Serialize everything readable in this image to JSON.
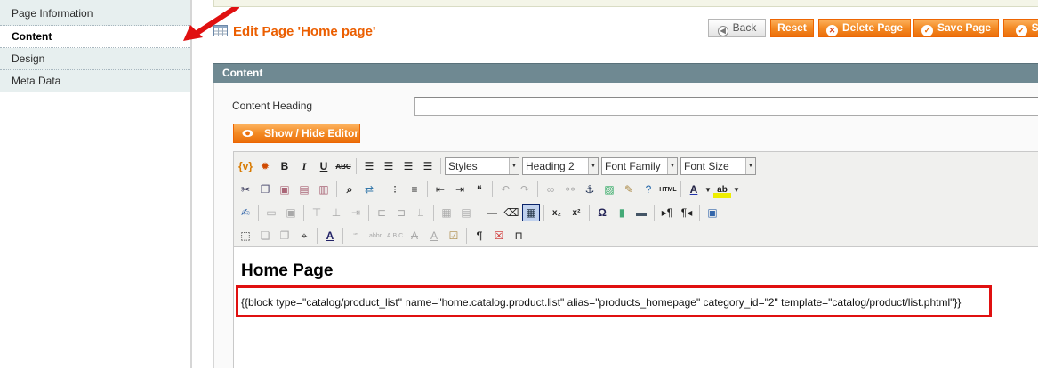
{
  "sidebar": {
    "items": [
      {
        "label": "Page Information",
        "active": false
      },
      {
        "label": "Content",
        "active": true
      },
      {
        "label": "Design",
        "active": false
      },
      {
        "label": "Meta Data",
        "active": false
      }
    ]
  },
  "header": {
    "title": "Edit Page 'Home page'"
  },
  "buttons": {
    "back": "Back",
    "reset": "Reset",
    "delete": "Delete Page",
    "save": "Save Page",
    "save_continue": "Sa"
  },
  "section": {
    "title": "Content"
  },
  "form": {
    "content_heading_label": "Content Heading",
    "content_heading_value": "",
    "toggle_editor_label": "Show / Hide Editor"
  },
  "editor": {
    "selects": {
      "styles": "Styles",
      "format": "Heading 2",
      "font_family": "Font Family",
      "font_size": "Font Size"
    },
    "content": {
      "heading": "Home Page",
      "widget_code": "{{block type=\"catalog/product_list\" name=\"home.catalog.product.list\" alias=\"products_homepage\" category_id=\"2\" template=\"catalog/product/list.phtml\"}}"
    }
  },
  "colors": {
    "accent_orange": "#eb5e00",
    "section_header": "#6f8992",
    "annotation_red": "#e01010"
  }
}
